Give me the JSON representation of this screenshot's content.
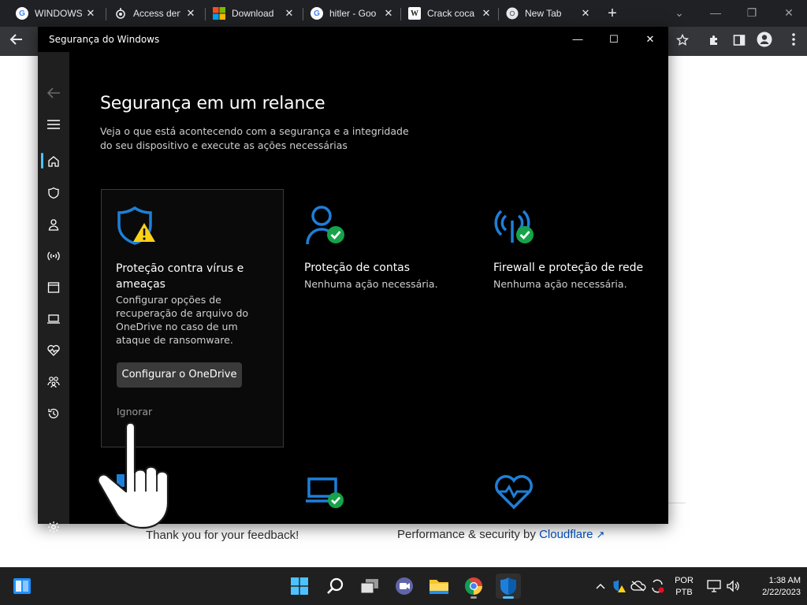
{
  "browser": {
    "tabs": [
      {
        "title": "WINDOWS",
        "icon": "google-icon"
      },
      {
        "title": "Access den",
        "icon": "tor-icon"
      },
      {
        "title": "Download",
        "icon": "microsoft-icon"
      },
      {
        "title": "hitler - Goo",
        "icon": "google-icon"
      },
      {
        "title": "Crack coca",
        "icon": "wikipedia-icon"
      },
      {
        "title": "New Tab",
        "icon": "chrome-icon"
      }
    ],
    "new_tab_glyph": "+",
    "page": {
      "feedback": "Thank you for your feedback!",
      "perf_prefix": "Performance & security by ",
      "perf_link": "Cloudflare"
    }
  },
  "security_window": {
    "title": "Segurança do Windows",
    "heading": "Segurança em um relance",
    "subheading": "Veja o que está acontecendo com a segurança e a integridade do seu dispositivo e execute as ações necessárias",
    "nav_items": [
      "back-icon",
      "menu-icon",
      "home-icon",
      "shield-icon",
      "account-icon",
      "wireless-icon",
      "app-browser-icon",
      "device-icon",
      "health-icon",
      "family-icon",
      "history-icon",
      "settings-icon"
    ],
    "cards": [
      {
        "title": "Proteção contra vírus e ameaças",
        "description": "Configurar opções de recuperação de arquivo do OneDrive no caso de um ataque de ransomware.",
        "button": "Configurar o OneDrive",
        "link": "Ignorar",
        "status": "warning"
      },
      {
        "title": "Proteção de contas",
        "description": "Nenhuma ação necessária.",
        "status": "ok"
      },
      {
        "title": "Firewall e proteção de rede",
        "description": "Nenhuma ação necessária.",
        "status": "ok"
      }
    ]
  },
  "taskbar": {
    "language": [
      "POR",
      "PTB"
    ],
    "time": "1:38 AM",
    "date": "2/22/2023"
  },
  "colors": {
    "accent_blue": "#1e7fd8",
    "ok_green": "#16a34a",
    "warn_yellow": "#fcd116",
    "nav_indicator": "#4cc2ff"
  }
}
